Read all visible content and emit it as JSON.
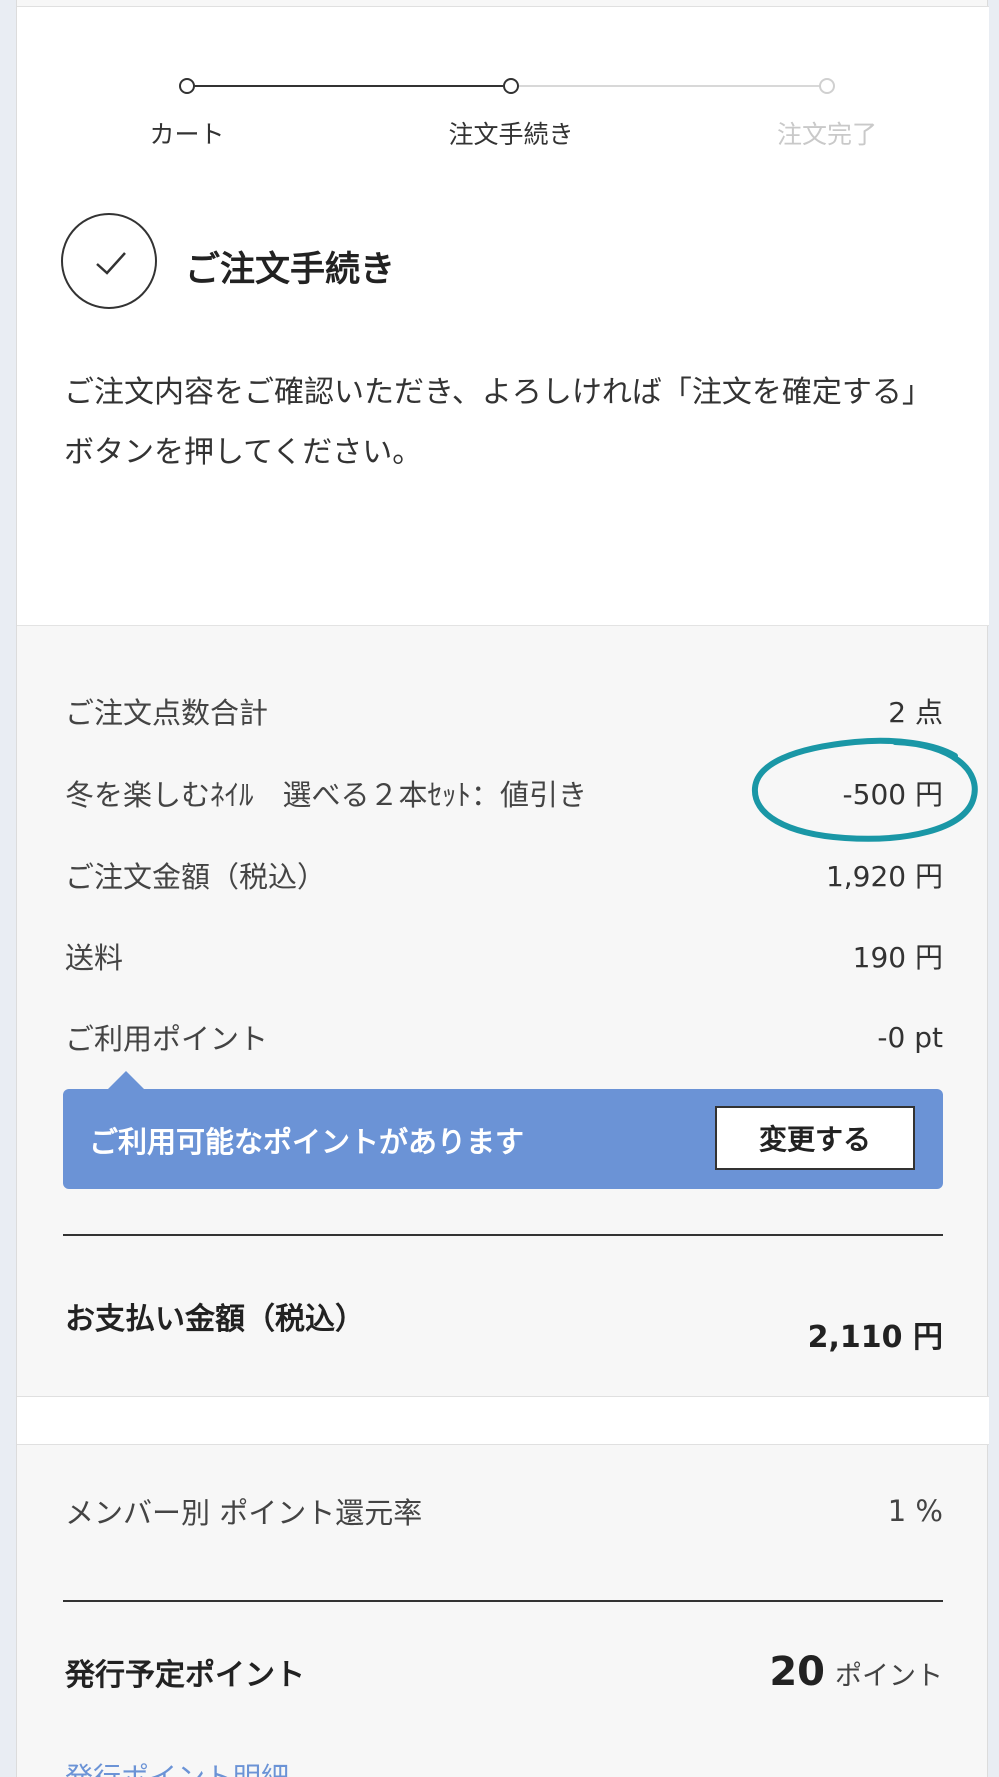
{
  "steps": [
    {
      "label": "カート",
      "state": "done"
    },
    {
      "label": "注文手続き",
      "state": "current"
    },
    {
      "label": "注文完了",
      "state": "todo"
    }
  ],
  "header": {
    "title": "ご注文手続き",
    "intro": "ご注文内容をご確認いただき、よろしければ「注文を確定する」ボタンを押してください。"
  },
  "summary": {
    "rows": [
      {
        "label": "ご注文点数合計",
        "value": "2 点"
      },
      {
        "label": "冬を楽しむﾈｲﾙ　選べる２本ｾｯﾄ：値引き",
        "value": "-500 円"
      },
      {
        "label": "ご注文金額（税込）",
        "value": "1,920 円"
      },
      {
        "label": "送料",
        "value": "190 円"
      },
      {
        "label": "ご利用ポイント",
        "value": "-0 pt"
      }
    ],
    "notice": {
      "text": "ご利用可能なポイントがあります",
      "button_label": "変更する"
    },
    "total": {
      "label": "お支払い金額（税込）",
      "value": "2,110 円"
    }
  },
  "points": {
    "rate_label": "メンバー別 ポイント還元率",
    "rate_value": "1 %",
    "issue_label": "発行予定ポイント",
    "issue_value": "20",
    "issue_unit": "ポイント",
    "detail_link": "発行ポイント明細"
  },
  "colors": {
    "accent": "#6b93d6",
    "annotation": "#1a97a6",
    "text": "#333333"
  }
}
